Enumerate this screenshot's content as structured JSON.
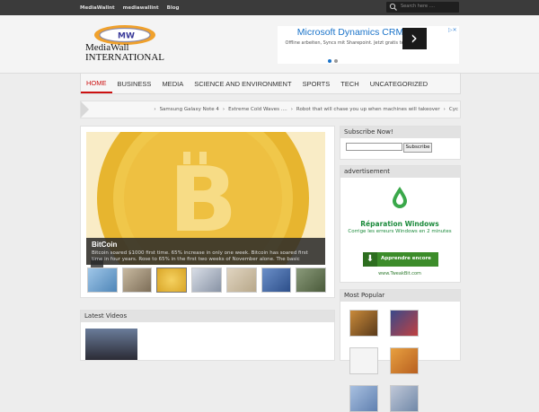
{
  "topbar": {
    "links": [
      "MediaWallnt",
      "mediawallint",
      "Blog"
    ],
    "search_placeholder": "Search here ...."
  },
  "header": {
    "logo_badge": "MW",
    "logo_line1": "MediaWall",
    "logo_line2": "INTERNATIONAL",
    "ad": {
      "title": "Microsoft Dynamics CRM",
      "subtitle": "Offline arbeiten, Syncs mit Sharepoint. Jetzt gratis testen!"
    }
  },
  "nav": {
    "items": [
      "HOME",
      "BUSINESS",
      "MEDIA",
      "SCIENCE AND ENVIRONMENT",
      "SPORTS",
      "TECH",
      "UNCATEGORIZED"
    ],
    "active_index": 0
  },
  "ticker": {
    "items": [
      "Samsung Galaxy Note 4",
      "Extreme Cold Waves ....",
      "Robot that will chase you up when machines will takeover",
      "Cyc"
    ]
  },
  "slider": {
    "badge_icon": "slideshow-icon",
    "title": "BitCoin",
    "excerpt": "Bitcoin soared $1000 first time. 65% increase in only one week.   Bitcoin has soared first time in four years. Rose to 65% in the first two weeks of November alone. The basic"
  },
  "latest_videos": {
    "title": "Latest Videos"
  },
  "sidebar": {
    "subscribe": {
      "title": "Subscribe Now!",
      "button": "Subscribe"
    },
    "advertisement": {
      "title": "advertisement",
      "ad_title": "Réparation Windows",
      "ad_sub": "Corrige les erreurs Windows en 2 minutes",
      "cta": "Apprendre encore",
      "url": "www.TweakBit.com"
    },
    "popular": {
      "title": "Most Popular"
    }
  },
  "colors": {
    "accent": "#cc1111",
    "topbar": "#3b3b3b",
    "coin": "#e8b830"
  }
}
